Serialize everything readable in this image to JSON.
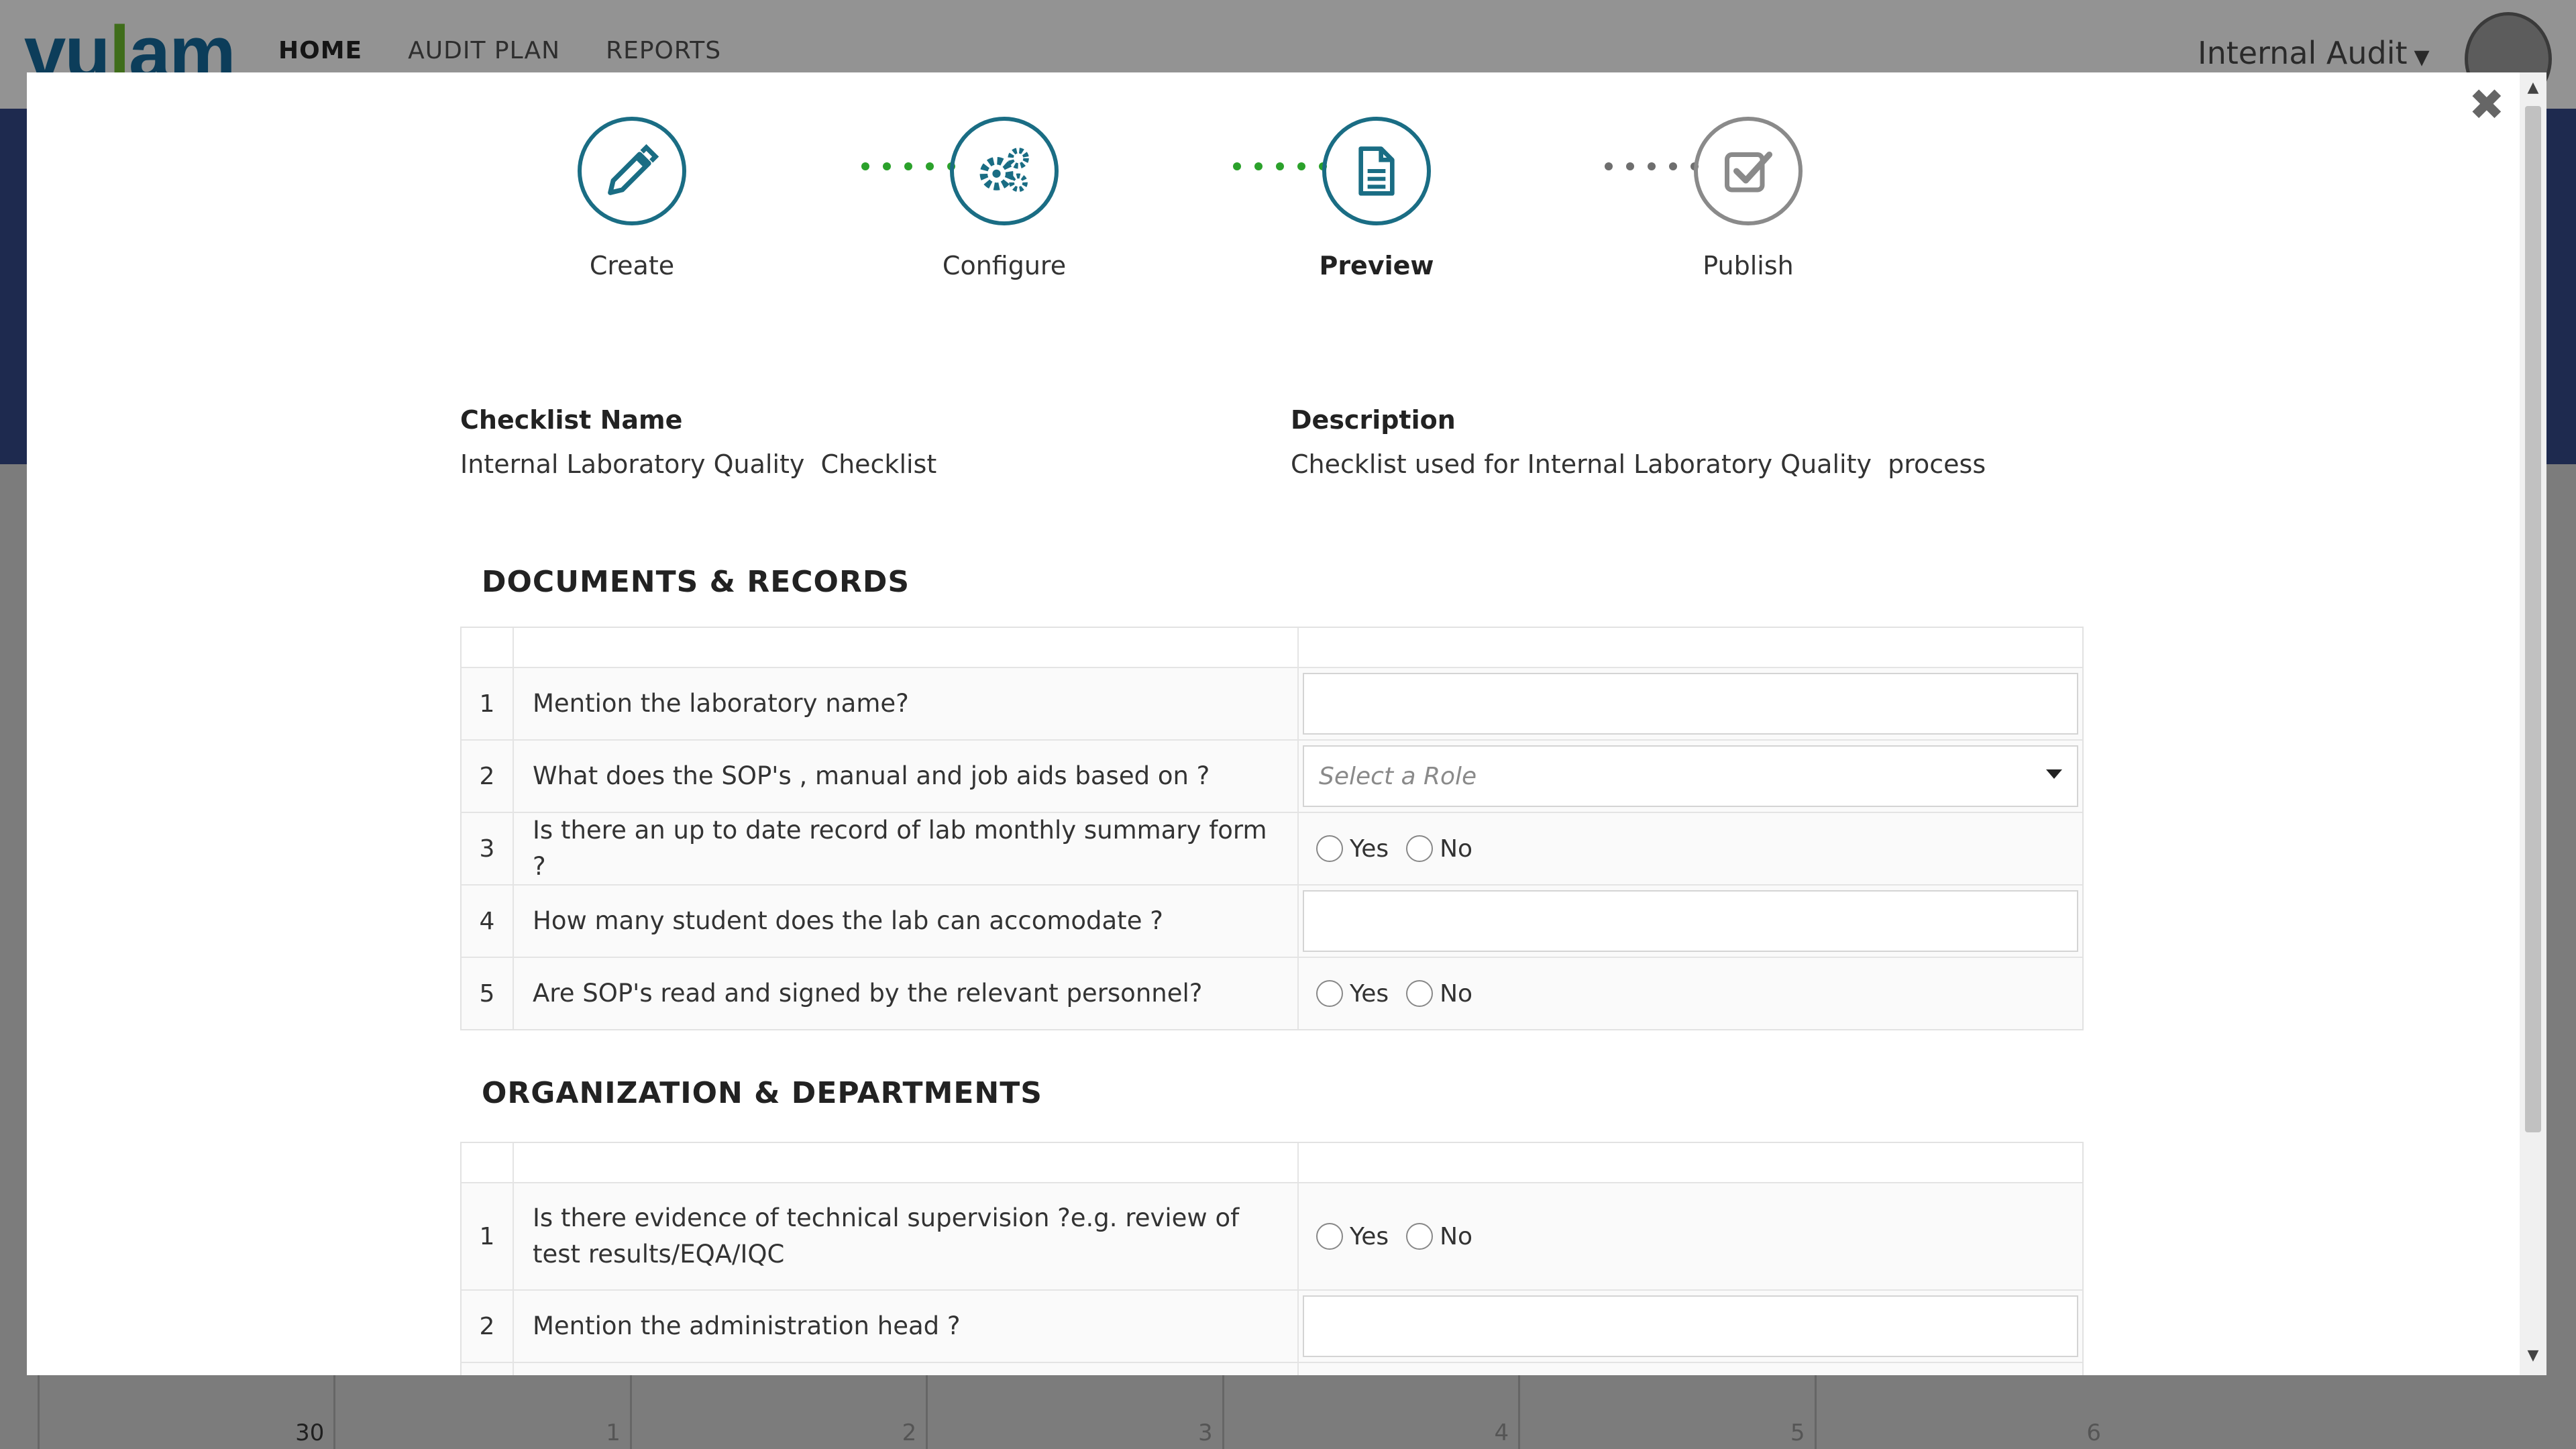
{
  "app": {
    "logo_text_pre": "vu",
    "logo_text_sprout": "l",
    "logo_text_post": "am",
    "nav": [
      "HOME",
      "AUDIT PLAN",
      "REPORTS"
    ],
    "user_menu_label": "Internal Audit"
  },
  "background_calendar": [
    "30",
    "1",
    "2",
    "3",
    "4",
    "5",
    "6"
  ],
  "wizard": {
    "steps": [
      {
        "label": "Create",
        "icon": "pencil-icon",
        "state": "done"
      },
      {
        "label": "Configure",
        "icon": "gears-icon",
        "state": "done"
      },
      {
        "label": "Preview",
        "icon": "document-icon",
        "state": "current"
      },
      {
        "label": "Publish",
        "icon": "checkbox-icon",
        "state": "pending"
      }
    ],
    "colors": {
      "active": "#1a6d84",
      "inactive": "#8a8a8a",
      "done_dots": "#2ba12b",
      "pending_dots": "#6e6e6e"
    }
  },
  "checklist": {
    "name_label": "Checklist Name",
    "name_value": "Internal Laboratory Quality  Checklist",
    "description_label": "Description",
    "description_value": "Checklist used for Internal Laboratory Quality  process"
  },
  "sections": [
    {
      "title": "DOCUMENTS & RECORDS",
      "questions": [
        {
          "num": "1",
          "text": "Mention the laboratory name?",
          "type": "text"
        },
        {
          "num": "2",
          "text": "What does the SOP's , manual and job aids based on  ?",
          "type": "select",
          "placeholder": "Select a Role"
        },
        {
          "num": "3",
          "text": "Is there an up to date record of lab monthly summary form ?",
          "type": "radio",
          "options": [
            "Yes",
            "No"
          ]
        },
        {
          "num": "4",
          "text": "How many student does the lab can accomodate ?",
          "type": "text"
        },
        {
          "num": "5",
          "text": "Are SOP's read and signed by the relevant personnel?",
          "type": "radio",
          "options": [
            "Yes",
            "No"
          ]
        }
      ]
    },
    {
      "title": "ORGANIZATION & DEPARTMENTS",
      "questions": [
        {
          "num": "1",
          "text": "Is there evidence of technical supervision ?e.g. review of test results/EQA/IQC",
          "type": "radio",
          "options": [
            "Yes",
            "No"
          ]
        },
        {
          "num": "2",
          "text": "Mention the administration head  ?",
          "type": "text"
        }
      ]
    }
  ]
}
